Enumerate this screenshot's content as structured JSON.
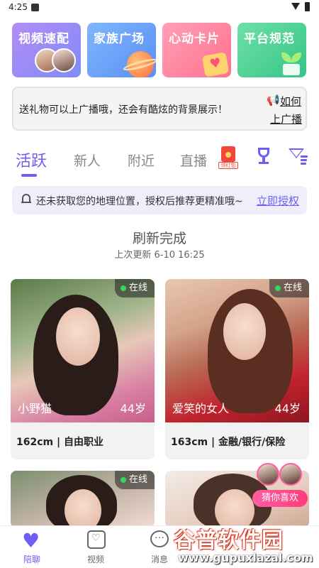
{
  "status": {
    "time": "4:25"
  },
  "features": [
    {
      "label": "视频速配",
      "icon": "video-match-avatars"
    },
    {
      "label": "家族广场",
      "icon": "planet-icon"
    },
    {
      "label": "心动卡片",
      "icon": "heart-card-icon"
    },
    {
      "label": "平台规范",
      "icon": "sprout-icon"
    }
  ],
  "notice": {
    "text": "送礼物可以上广播哦，还会有酷炫的背景展示！",
    "link_line1": "如何",
    "link_line2": "上广播"
  },
  "tabs": [
    {
      "label": "活跃",
      "active": true
    },
    {
      "label": "新人",
      "active": false
    },
    {
      "label": "附近",
      "active": false
    },
    {
      "label": "直播",
      "active": false
    }
  ],
  "redpacket": {
    "tag": "领红包"
  },
  "location": {
    "text": "还未获取您的地理位置，授权后推荐更精准哦~",
    "action": "立即授权"
  },
  "refresh": {
    "title": "刷新完成",
    "subtitle": "上次更新 6-10 16:25"
  },
  "profiles": [
    {
      "name": "小野猫",
      "age": "44岁",
      "status": "在线",
      "height": "162cm",
      "occupation": "自由职业"
    },
    {
      "name": "爱笑的女人",
      "age": "44岁",
      "status": "在线",
      "height": "163cm",
      "occupation": "金融/银行/保险"
    },
    {
      "status": "在线"
    },
    {}
  ],
  "guess_like": {
    "label": "猜你喜欢"
  },
  "bottom_nav": [
    {
      "label": "陪聊",
      "icon": "heart-pulse-icon",
      "active": true
    },
    {
      "label": "视频",
      "icon": "video-heart-icon",
      "active": false
    },
    {
      "label": "消息",
      "icon": "message-icon",
      "active": false
    }
  ],
  "watermark": {
    "title": "谷普软件园",
    "url": "www.gupuxlazal.com"
  },
  "colors": {
    "accent": "#6f5ef5",
    "online": "#3ad45c",
    "guess_like": "#ff4c8b"
  }
}
